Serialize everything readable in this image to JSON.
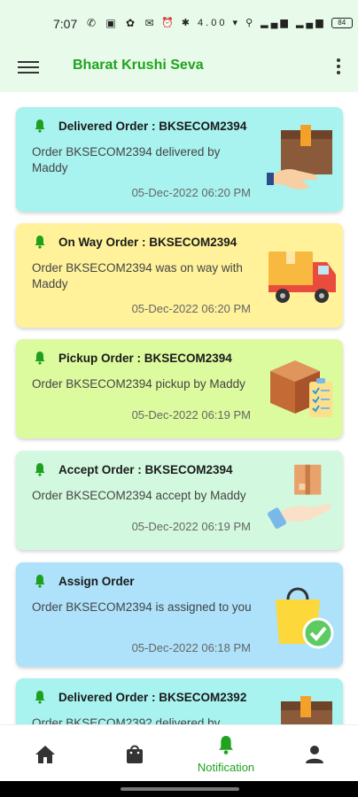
{
  "status_bar": {
    "time": "7:07",
    "left_icons": "✆ ▣ ✿ ✉ •",
    "right_icons": "⏰ ✱ 4.00 ▾ ⚲ ▂▄▆ ▂▄▆",
    "battery": "84"
  },
  "app_bar": {
    "title": "Bharat Krushi Seva",
    "menu_icon": "hamburger-icon",
    "more_icon": "more-vert-icon"
  },
  "notifications": [
    {
      "title": "Delivered Order : BKSECOM2394",
      "message": "Order BKSECOM2394 delivered by Maddy",
      "date": "05-Dec-2022 06:20 PM",
      "icon": "package-delivered-icon",
      "color": "#a8f3ef"
    },
    {
      "title": "On Way Order : BKSECOM2394",
      "message": "Order BKSECOM2394 was on way with Maddy",
      "date": "05-Dec-2022 06:20 PM",
      "icon": "delivery-truck-icon",
      "color": "#fff29a"
    },
    {
      "title": "Pickup Order : BKSECOM2394",
      "message": "Order BKSECOM2394 pickup by Maddy",
      "date": "05-Dec-2022 06:19 PM",
      "icon": "box-checklist-icon",
      "color": "#dcfa9e"
    },
    {
      "title": "Accept Order : BKSECOM2394",
      "message": "Order BKSECOM2394 accept by Maddy",
      "date": "05-Dec-2022 06:19 PM",
      "icon": "hand-package-icon",
      "color": "#d2f9df"
    },
    {
      "title": "Assign Order",
      "message": "Order BKSECOM2394 is assigned to you",
      "date": "05-Dec-2022 06:18 PM",
      "icon": "shopping-bag-check-icon",
      "color": "#ade2fa"
    },
    {
      "title": "Delivered Order : BKSECOM2392",
      "message": "Order BKSECOM2392 delivered by",
      "date": "",
      "icon": "package-delivered-icon",
      "color": "#a8f3ef"
    }
  ],
  "bottom_nav": {
    "items": [
      {
        "icon": "home-icon",
        "label": ""
      },
      {
        "icon": "shopping-bag-icon",
        "label": ""
      },
      {
        "icon": "bell-icon",
        "label": "Notification",
        "active": true
      },
      {
        "icon": "person-icon",
        "label": ""
      }
    ],
    "active_color": "#1fa31f"
  }
}
